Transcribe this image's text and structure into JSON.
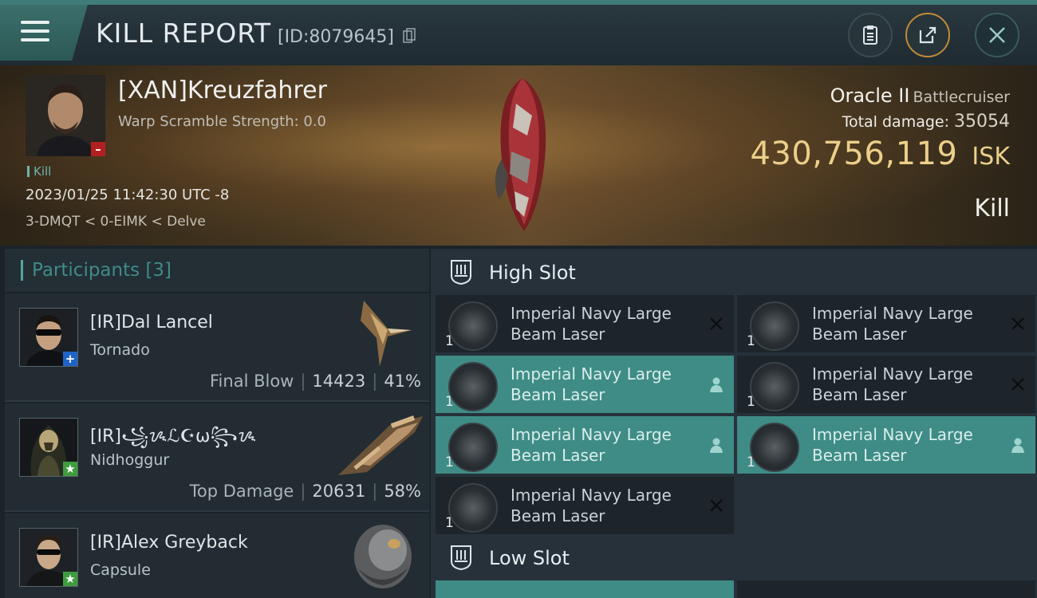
{
  "header": {
    "title": "KILL REPORT",
    "report_id": "[ID:8079645]"
  },
  "victim": {
    "name": "[XAN]Kreuzfahrer",
    "warp_scramble": "Warp Scramble Strength: 0.0",
    "kill_tag": "Kill",
    "datetime": "2023/01/25 11:42:30 UTC -8",
    "location": "3-DMQT < 0-EIMK < Delve",
    "ship_name": "Oracle II",
    "ship_class": "Battlecruiser",
    "total_damage_label": "Total damage:",
    "total_damage": "35054",
    "isk_value": "430,756,119",
    "isk_unit": "ISK",
    "kill_type": "Kill"
  },
  "participants": {
    "title": "Participants [3]",
    "rows": [
      {
        "name": "[IR]Dal Lancel",
        "ship": "Tornado",
        "role": "Final Blow",
        "damage": "14423",
        "percent": "41%"
      },
      {
        "name": "[IR]꧁ᝰℒ☪ω꧂ᝰ",
        "ship": "Nidhoggur",
        "role": "Top Damage",
        "damage": "20631",
        "percent": "58%"
      },
      {
        "name": "[IR]Alex Greyback",
        "ship": "Capsule"
      }
    ]
  },
  "slots": {
    "high_slot_label": "High Slot",
    "low_slot_label": "Low Slot",
    "high": [
      {
        "name": "Imperial Navy Large Beam Laser",
        "qty": "1",
        "status": "destroyed"
      },
      {
        "name": "Imperial Navy Large Beam Laser",
        "qty": "1",
        "status": "destroyed"
      },
      {
        "name": "Imperial Navy Large Beam Laser",
        "qty": "1",
        "status": "dropped"
      },
      {
        "name": "Imperial Navy Large Beam Laser",
        "qty": "1",
        "status": "destroyed"
      },
      {
        "name": "Imperial Navy Large Beam Laser",
        "qty": "1",
        "status": "dropped"
      },
      {
        "name": "Imperial Navy Large Beam Laser",
        "qty": "1",
        "status": "dropped"
      },
      {
        "name": "Imperial Navy Large Beam Laser",
        "qty": "1",
        "status": "destroyed"
      }
    ]
  },
  "colors": {
    "accent": "#3f8c86",
    "isk": "#ebcf8a",
    "badge_blue": "#1f63c9",
    "badge_green": "#3f9c3f",
    "badge_red": "#b32020"
  }
}
